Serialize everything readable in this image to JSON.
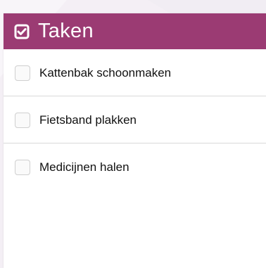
{
  "header": {
    "icon": "check-square-icon",
    "title": "Taken"
  },
  "tasks": [
    {
      "label": "Kattenbak schoonmaken",
      "checked": false
    },
    {
      "label": "Fietsband plakken",
      "checked": false
    },
    {
      "label": "Medicijnen halen",
      "checked": false
    }
  ],
  "colors": {
    "header_bg": "#9b3b73",
    "header_text": "#ffffff"
  }
}
